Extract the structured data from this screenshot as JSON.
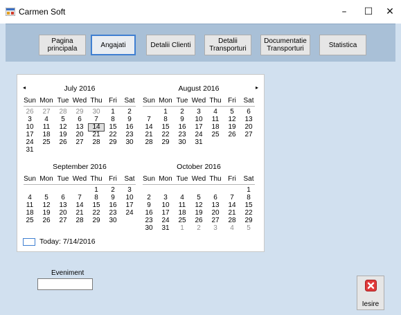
{
  "window": {
    "title": "Carmen Soft",
    "minimize": "–",
    "maximize": "☐",
    "close": "✕",
    "icon": "app-window-icon"
  },
  "nav": [
    {
      "label": "Pagina\nprincipala",
      "active": false
    },
    {
      "label": "Angajati",
      "active": true
    },
    {
      "label": "Detalii Clienti",
      "active": false
    },
    {
      "label": "Detalii\nTransporturi",
      "active": false
    },
    {
      "label": "Documentatie\nTransporturi",
      "active": false
    },
    {
      "label": "Statistica",
      "active": false
    }
  ],
  "calendar": {
    "prev_arrow": "◂",
    "next_arrow": "▸",
    "dow": [
      "Sun",
      "Mon",
      "Tue",
      "Wed",
      "Thu",
      "Fri",
      "Sat"
    ],
    "months": [
      {
        "title": "July 2016",
        "days": [
          [
            "26",
            "27",
            "28",
            "29",
            "30",
            "1",
            "2"
          ],
          [
            "3",
            "4",
            "5",
            "6",
            "7",
            "8",
            "9"
          ],
          [
            "10",
            "11",
            "12",
            "13",
            "14",
            "15",
            "16"
          ],
          [
            "17",
            "18",
            "19",
            "20",
            "21",
            "22",
            "23"
          ],
          [
            "24",
            "25",
            "26",
            "27",
            "28",
            "29",
            "30"
          ],
          [
            "31",
            "",
            "",
            "",
            "",
            "",
            ""
          ]
        ],
        "dim": [
          [
            0,
            0
          ],
          [
            0,
            1
          ],
          [
            0,
            2
          ],
          [
            0,
            3
          ],
          [
            0,
            4
          ]
        ],
        "today": [
          2,
          4
        ]
      },
      {
        "title": "August 2016",
        "days": [
          [
            "",
            "1",
            "2",
            "3",
            "4",
            "5",
            "6"
          ],
          [
            "7",
            "8",
            "9",
            "10",
            "11",
            "12",
            "13"
          ],
          [
            "14",
            "15",
            "16",
            "17",
            "18",
            "19",
            "20"
          ],
          [
            "21",
            "22",
            "23",
            "24",
            "25",
            "26",
            "27"
          ],
          [
            "28",
            "29",
            "30",
            "31",
            "",
            "",
            ""
          ]
        ],
        "dim": [],
        "today": null
      },
      {
        "title": "September 2016",
        "days": [
          [
            "",
            "",
            "",
            "",
            "1",
            "2",
            "3"
          ],
          [
            "4",
            "5",
            "6",
            "7",
            "8",
            "9",
            "10"
          ],
          [
            "11",
            "12",
            "13",
            "14",
            "15",
            "16",
            "17"
          ],
          [
            "18",
            "19",
            "20",
            "21",
            "22",
            "23",
            "24"
          ],
          [
            "25",
            "26",
            "27",
            "28",
            "29",
            "30",
            ""
          ]
        ],
        "dim": [],
        "today": null
      },
      {
        "title": "October 2016",
        "days": [
          [
            "",
            "",
            "",
            "",
            "",
            "",
            "1"
          ],
          [
            "2",
            "3",
            "4",
            "5",
            "6",
            "7",
            "8"
          ],
          [
            "9",
            "10",
            "11",
            "12",
            "13",
            "14",
            "15"
          ],
          [
            "16",
            "17",
            "18",
            "19",
            "20",
            "21",
            "22"
          ],
          [
            "23",
            "24",
            "25",
            "26",
            "27",
            "28",
            "29"
          ],
          [
            "30",
            "31",
            "1",
            "2",
            "3",
            "4",
            "5"
          ]
        ],
        "dim": [
          [
            5,
            2
          ],
          [
            5,
            3
          ],
          [
            5,
            4
          ],
          [
            5,
            5
          ],
          [
            5,
            6
          ]
        ],
        "today": null
      }
    ],
    "today_text": "Today: 7/14/2016"
  },
  "event": {
    "label": "Eveniment",
    "value": ""
  },
  "exit": {
    "label": "Iesire",
    "icon": "exit-x-icon",
    "color": "#e03a3a"
  },
  "colors": {
    "client_bg": "#d1e0ef",
    "nav_bg": "#a9c0d7",
    "accent": "#3f7fd1"
  }
}
